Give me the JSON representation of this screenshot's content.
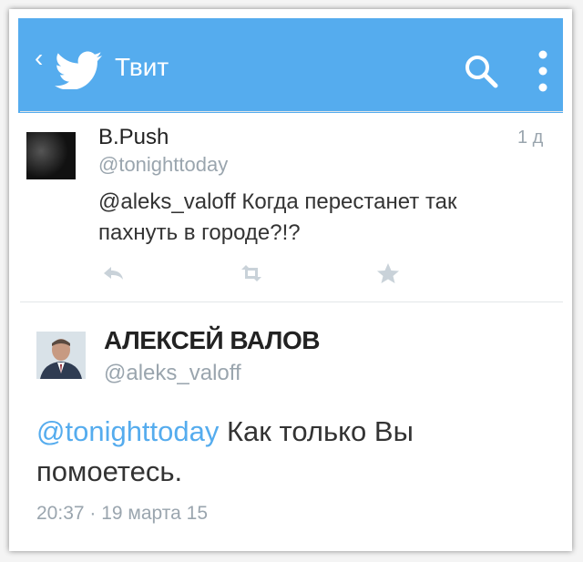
{
  "header": {
    "back_glyph": "‹",
    "title": "Твит",
    "bg_color": "#55acee",
    "icons": [
      "back-icon",
      "twitter-bird-icon",
      "search-icon",
      "more-vertical-icon"
    ]
  },
  "tweet": {
    "author_name": "B.Push",
    "author_handle": "@tonighttoday",
    "time": "1 д",
    "mention": "@aleks_valoff",
    "text": " Когда перестанет так пахнуть в городе?!?",
    "actions": [
      "reply-icon",
      "retweet-icon",
      "favorite-icon"
    ]
  },
  "reply": {
    "author_name": "АЛЕКСЕЙ ВАЛОВ",
    "author_handle": "@aleks_valoff",
    "mention": "@tonighttoday",
    "text": " Как только Вы помоетесь.",
    "timestamp": "20:37 · 19 марта 15"
  }
}
